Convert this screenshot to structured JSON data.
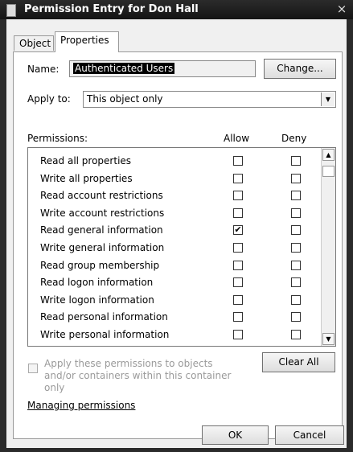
{
  "window": {
    "title": "Permission Entry for Don Hall",
    "close_glyph": "×"
  },
  "tabs": [
    {
      "label": "Object"
    },
    {
      "label": "Properties"
    }
  ],
  "name": {
    "label": "Name:",
    "value": "Authenticated Users",
    "change_button": "Change..."
  },
  "apply_to": {
    "label": "Apply to:",
    "value": "This object only"
  },
  "permissions": {
    "header": "Permissions:",
    "allow_header": "Allow",
    "deny_header": "Deny",
    "rows": [
      {
        "label": "Read all properties",
        "allow": false,
        "deny": false
      },
      {
        "label": "Write all properties",
        "allow": false,
        "deny": false
      },
      {
        "label": "Read account restrictions",
        "allow": false,
        "deny": false
      },
      {
        "label": "Write account restrictions",
        "allow": false,
        "deny": false
      },
      {
        "label": "Read general information",
        "allow": true,
        "deny": false
      },
      {
        "label": "Write general information",
        "allow": false,
        "deny": false
      },
      {
        "label": "Read group membership",
        "allow": false,
        "deny": false
      },
      {
        "label": "Read logon information",
        "allow": false,
        "deny": false
      },
      {
        "label": "Write logon information",
        "allow": false,
        "deny": false
      },
      {
        "label": "Read personal information",
        "allow": false,
        "deny": false
      },
      {
        "label": "Write personal information",
        "allow": false,
        "deny": false
      }
    ]
  },
  "apply_inherit": {
    "label": "Apply these permissions to objects and/or containers within this container only",
    "checked": false,
    "enabled": false
  },
  "clear_all_button": "Clear All",
  "manage_link": "Managing permissions",
  "ok_button": "OK",
  "cancel_button": "Cancel",
  "check_glyph": "✔"
}
